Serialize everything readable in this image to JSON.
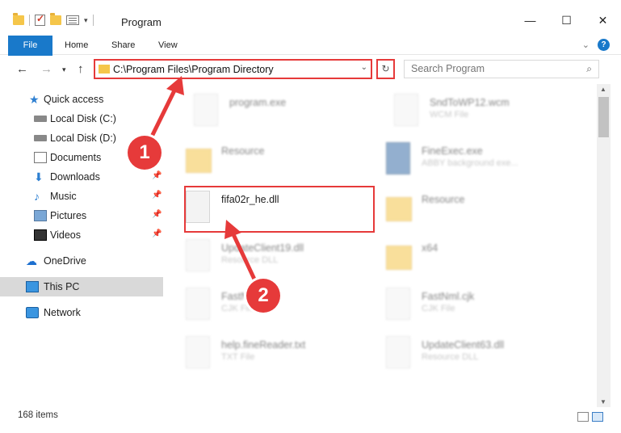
{
  "window": {
    "title": "Program",
    "controls": {
      "minimize": "—",
      "maximize": "☐",
      "close": "✕"
    }
  },
  "ribbon": {
    "tabs": [
      "File",
      "Home",
      "Share",
      "View"
    ],
    "help": "?"
  },
  "address_bar": {
    "path": "C:\\Program Files\\Program Directory"
  },
  "search": {
    "placeholder": "Search Program"
  },
  "sidebar": {
    "items": [
      {
        "label": "Quick access",
        "icon": "star-icon"
      },
      {
        "label": "Local Disk (C:)",
        "icon": "drive-icon"
      },
      {
        "label": "Local Disk (D:)",
        "icon": "drive-icon"
      },
      {
        "label": "Documents",
        "icon": "documents-icon"
      },
      {
        "label": "Downloads",
        "icon": "download-icon"
      },
      {
        "label": "Music",
        "icon": "music-icon"
      },
      {
        "label": "Pictures",
        "icon": "pictures-icon"
      },
      {
        "label": "Videos",
        "icon": "videos-icon"
      },
      {
        "label": "OneDrive",
        "icon": "cloud-icon"
      },
      {
        "label": "This PC",
        "icon": "computer-icon"
      },
      {
        "label": "Network",
        "icon": "network-icon"
      }
    ],
    "selected": "This PC"
  },
  "files": [
    {
      "name": "program.exe",
      "type": ""
    },
    {
      "name": "SndToWP12.wcm",
      "type": "WCM File"
    },
    {
      "name": "Resource",
      "type": ""
    },
    {
      "name": "FineExec.exe",
      "type": "ABBY background exe..."
    },
    {
      "name": "fifa02r_he.dll",
      "type": ""
    },
    {
      "name": "Resource",
      "type": ""
    },
    {
      "name": "UpdateClient19.dll",
      "type": "Resource DLL"
    },
    {
      "name": "x64",
      "type": ""
    },
    {
      "name": "FastNm..",
      "type": "CJK File"
    },
    {
      "name": "FastNml.cjk",
      "type": "CJK File"
    },
    {
      "name": "help.fineReader.txt",
      "type": "TXT File"
    },
    {
      "name": "UpdateClient63.dll",
      "type": "Resource DLL"
    }
  ],
  "status": {
    "count": "168 items"
  },
  "callouts": [
    "1",
    "2"
  ],
  "colors": {
    "accent": "#1979ca",
    "highlight": "#e63a3a"
  }
}
